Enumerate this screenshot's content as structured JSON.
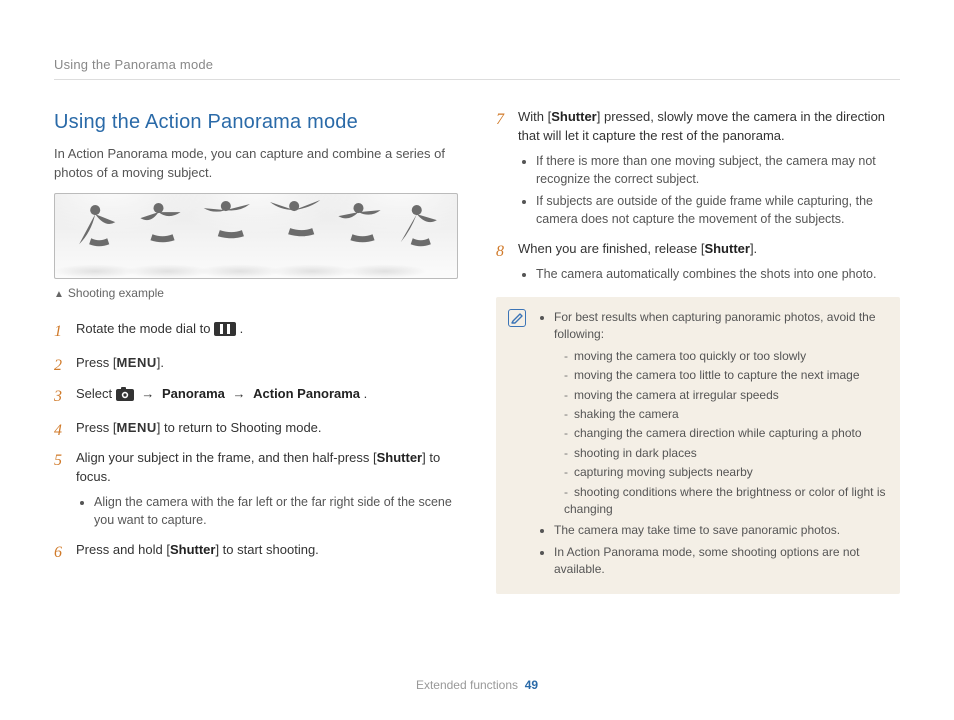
{
  "header": {
    "breadcrumb": "Using the Panorama mode"
  },
  "title": "Using the Action Panorama mode",
  "intro": "In Action Panorama mode, you can capture and combine a series of photos of a moving subject.",
  "caption": "Shooting example",
  "labels": {
    "menu": "MENU",
    "shutter": "Shutter",
    "panorama": "Panorama",
    "action_panorama": "Action Panorama"
  },
  "steps_left": {
    "s1_a": "Rotate the mode dial to ",
    "s1_b": ".",
    "s2_a": "Press [",
    "s2_b": "].",
    "s3_a": "Select ",
    "s3_b": ".",
    "s4_a": "Press [",
    "s4_b": "] to return to Shooting mode.",
    "s5_a": "Align your subject in the frame, and then half-press [",
    "s5_b": "] to focus.",
    "s5_sub1": "Align the camera with the far left or the far right side of the scene you want to capture.",
    "s6_a": "Press and hold [",
    "s6_b": "] to start shooting."
  },
  "steps_right": {
    "s7_a": "With [",
    "s7_b": "] pressed, slowly move the camera in the direction that will let it capture the rest of the panorama.",
    "s7_sub1": "If there is more than one moving subject, the camera may not recognize the correct subject.",
    "s7_sub2": "If subjects are outside of the guide frame while capturing, the camera does not capture the movement of the subjects.",
    "s8_a": "When you are finished, release [",
    "s8_b": "].",
    "s8_sub1": "The camera automatically combines the shots into one photo."
  },
  "note": {
    "lead": "For best results when capturing panoramic photos, avoid the following:",
    "avoid": [
      "moving the camera too quickly or too slowly",
      "moving the camera too little to capture the next image",
      "moving the camera at irregular speeds",
      "shaking the camera",
      "changing the camera direction while capturing a photo",
      "shooting in dark places",
      "capturing moving subjects nearby",
      "shooting conditions where the brightness or color of light is changing"
    ],
    "b2": "The camera may take time to save panoramic photos.",
    "b3": "In Action Panorama mode, some shooting options are not available."
  },
  "footer": {
    "section": "Extended functions",
    "page": "49"
  }
}
